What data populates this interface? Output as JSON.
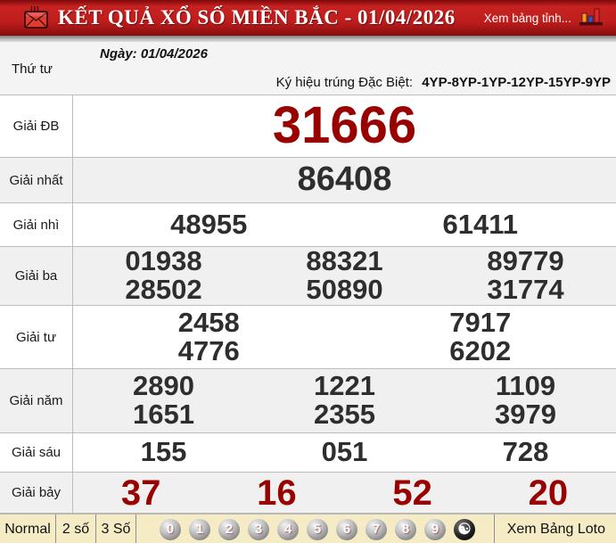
{
  "header": {
    "title": "KẾT QUẢ XỔ SỐ MIỀN BẮC - 01/04/2026",
    "right_link": "Xem bảng tỉnh..."
  },
  "info": {
    "weekday": "Thứ tư",
    "date": "Ngày: 01/04/2026",
    "symbol_label": "Ký hiệu trúng Đặc Biệt:",
    "symbol_value": "4YP-8YP-1YP-12YP-15YP-9YP"
  },
  "results": {
    "rows": [
      {
        "label": "Giải ĐB",
        "lines": [
          [
            "31666"
          ]
        ]
      },
      {
        "label": "Giải nhất",
        "lines": [
          [
            "86408"
          ]
        ]
      },
      {
        "label": "Giải nhì",
        "lines": [
          [
            "48955",
            "61411"
          ]
        ]
      },
      {
        "label": "Giải ba",
        "lines": [
          [
            "01938",
            "88321",
            "89779"
          ],
          [
            "28502",
            "50890",
            "31774"
          ]
        ]
      },
      {
        "label": "Giải tư",
        "lines": [
          [
            "2458",
            "7917"
          ],
          [
            "4776",
            "6202"
          ]
        ]
      },
      {
        "label": "Giải năm",
        "lines": [
          [
            "2890",
            "1221",
            "1109"
          ],
          [
            "1651",
            "2355",
            "3979"
          ]
        ]
      },
      {
        "label": "Giải sáu",
        "lines": [
          [
            "155",
            "051",
            "728"
          ]
        ]
      },
      {
        "label": "Giải bảy",
        "lines": [
          [
            "37",
            "16",
            "52",
            "20"
          ]
        ]
      }
    ]
  },
  "footer": {
    "tabs": [
      "Normal",
      "2 số",
      "3 Số"
    ],
    "balls": [
      "0",
      "1",
      "2",
      "3",
      "4",
      "5",
      "6",
      "7",
      "8",
      "9"
    ],
    "yinyang": "☯",
    "loto_link": "Xem Bảng Loto"
  },
  "colors": {
    "header_red": "#c01d1d",
    "special_number_red": "#990000",
    "number_gray": "#2e2e2e",
    "footer_beige": "#f5ecc6",
    "row_alt_gray": "#f0f0f0"
  }
}
